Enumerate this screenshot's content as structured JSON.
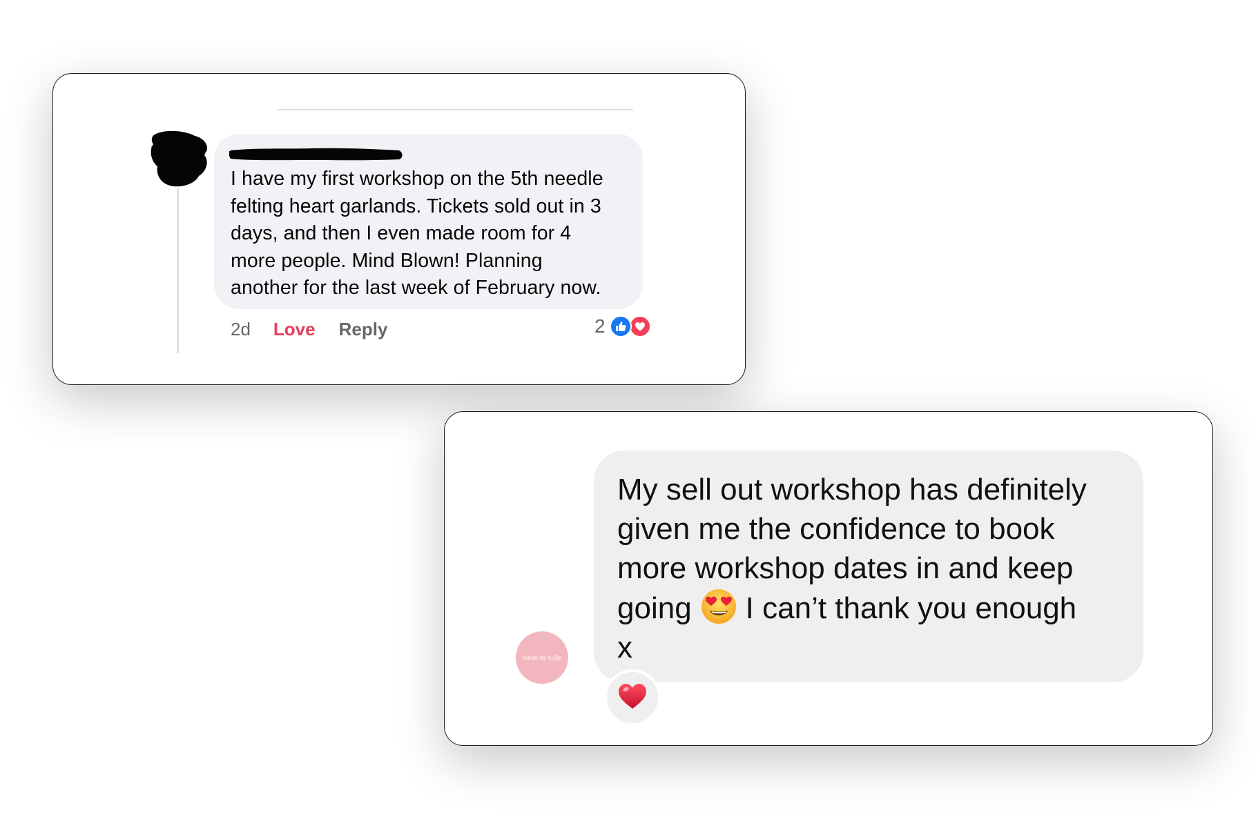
{
  "facebook_comment": {
    "body_lines": [
      "I have my first workshop on the 5th needle",
      "felting heart garlands. Tickets sold out in 3",
      "days, and then I even made room for 4",
      "more people. Mind Blown! Planning",
      "another for the last week of February now."
    ],
    "timestamp": "2d",
    "love_label": "Love",
    "reply_label": "Reply",
    "reaction_count": "2",
    "reaction_icons": [
      "like-icon",
      "love-icon"
    ],
    "colors": {
      "bubble": "#f0f2f5",
      "love_text": "#e4405f",
      "like_icon": "#1877f2",
      "love_icon": "#f33e58",
      "meta_text": "#65676b"
    }
  },
  "instagram_message": {
    "line_1": "My sell out workshop has definitely",
    "line_2": "given me the confidence to book",
    "line_3": "more workshop dates in and keep",
    "line_4_before_emoji": "going",
    "emoji_icon": "heart-eyes-emoji-icon",
    "line_4_after_emoji": "I can’t thank you enough",
    "line_5": "x",
    "avatar_text": "made by holly",
    "reaction_icon": "red-heart-icon",
    "colors": {
      "bubble": "#efefef",
      "avatar": "#f2b6bf",
      "heart": "#e0202f"
    }
  }
}
